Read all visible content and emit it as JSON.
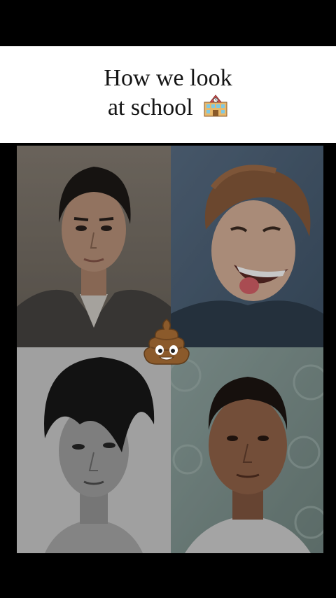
{
  "caption": {
    "line1": "How we look",
    "line2": "at school"
  },
  "emojis": {
    "school": "school-building-icon",
    "center": "pile-of-poo-icon"
  },
  "colors": {
    "background": "#000000",
    "caption_band": "#ffffff",
    "caption_text": "#141414"
  }
}
